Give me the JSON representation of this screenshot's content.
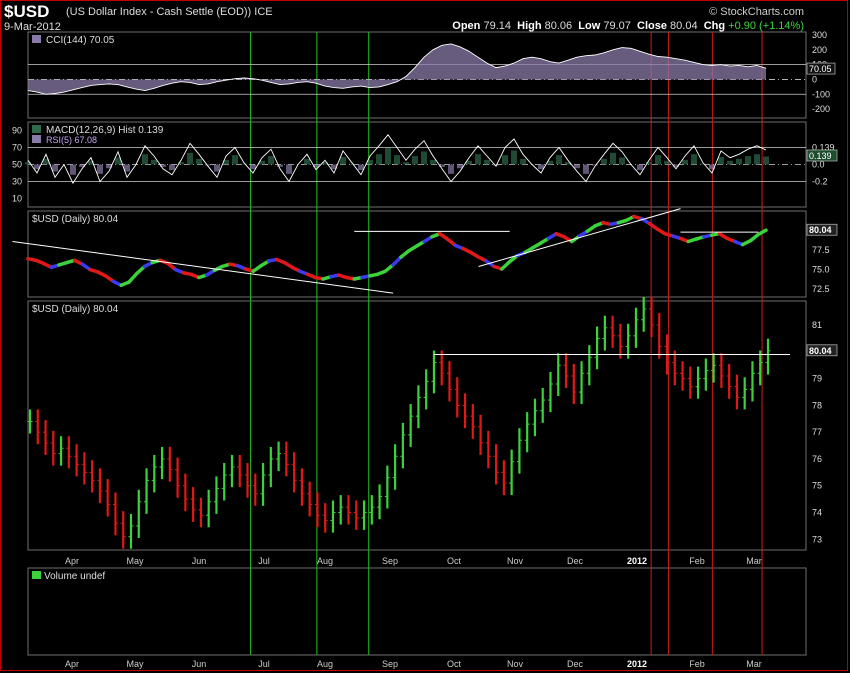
{
  "header": {
    "symbol": "$USD",
    "description": "(US Dollar Index - Cash Settle (EOD))",
    "exchange": "ICE",
    "date": "9-Mar-2012",
    "brand": "© StockCharts.com",
    "open_label": "Open",
    "open": "79.14",
    "high_label": "High",
    "high": "80.06",
    "low_label": "Low",
    "low": "79.07",
    "close_label": "Close",
    "close": "80.04",
    "chg_label": "Chg",
    "chg": "+0.90 (+1.14%)"
  },
  "colors": {
    "background": "#000000",
    "frame": "#c00000",
    "panel_border": "#6e6e6e",
    "up_bar": "#3cd23c",
    "down_bar": "#e01818",
    "blue_bar": "#3a3af0",
    "oscillator_fill": "#8a7aa8",
    "hist_fill": "#2f6a4a",
    "line": "#ffffff",
    "green_vline": "#20c020",
    "red_vline": "#d01a1a"
  },
  "chart_data": [
    {
      "type": "area",
      "name": "cci-panel",
      "title": "CCI(144) 70.05",
      "ylim": [
        -260,
        320
      ],
      "y_ticks": [
        300,
        200,
        100,
        0,
        -100,
        -200
      ],
      "ref_lines": [
        100,
        0,
        -100
      ],
      "last_value_label": "70.05",
      "values": [
        -75,
        -85,
        -100,
        -95,
        -85,
        -70,
        -55,
        -40,
        -35,
        -30,
        -35,
        -50,
        -65,
        -75,
        -60,
        -40,
        -25,
        -15,
        -20,
        -35,
        -30,
        -15,
        -5,
        5,
        10,
        5,
        -5,
        -20,
        -35,
        -30,
        -20,
        -15,
        -25,
        -45,
        -55,
        -60,
        -50,
        -45,
        -55,
        -50,
        -35,
        -15,
        20,
        80,
        150,
        200,
        230,
        240,
        220,
        190,
        150,
        110,
        80,
        90,
        110,
        140,
        150,
        140,
        120,
        110,
        130,
        150,
        160,
        165,
        180,
        200,
        215,
        210,
        190,
        170,
        155,
        150,
        140,
        130,
        115,
        100,
        95,
        100,
        90,
        95,
        85,
        95,
        75
      ]
    },
    {
      "type": "line",
      "name": "rsi-macd-panel",
      "title": "MACD(12,26,9) Hist 0.139",
      "subtitle": "RSI(5) 67.08",
      "ylim": [
        0,
        100
      ],
      "y_ticks": [
        90,
        70,
        50,
        30,
        10
      ],
      "ref_lines": [
        70,
        50,
        30
      ],
      "right_ticks": [
        "0.139",
        "0.0",
        "-0.2"
      ],
      "last_value_label": "0.139",
      "values": [
        55,
        40,
        62,
        35,
        50,
        28,
        45,
        58,
        30,
        42,
        65,
        35,
        50,
        72,
        60,
        45,
        38,
        55,
        75,
        62,
        48,
        35,
        60,
        70,
        52,
        40,
        58,
        68,
        45,
        30,
        50,
        62,
        44,
        55,
        40,
        66,
        52,
        38,
        60,
        72,
        85,
        70,
        55,
        68,
        78,
        60,
        45,
        30,
        42,
        58,
        72,
        60,
        48,
        70,
        80,
        62,
        50,
        40,
        58,
        70,
        55,
        42,
        30,
        48,
        62,
        75,
        65,
        50,
        38,
        55,
        70,
        58,
        45,
        60,
        72,
        52,
        40,
        66,
        58,
        62,
        68,
        72,
        67.08
      ]
    },
    {
      "type": "line",
      "name": "daily-line-panel",
      "title": "$USD (Daily) 80.04",
      "ylim": [
        71.5,
        82.5
      ],
      "y_ticks": [
        80,
        77.5,
        75,
        72.5
      ],
      "last_value_label": "80.04",
      "values": [
        76.4,
        76.2,
        75.8,
        75.3,
        75.6,
        75.9,
        76.2,
        75.7,
        75.0,
        74.7,
        74.2,
        73.5,
        73.0,
        73.4,
        74.5,
        75.4,
        75.9,
        76.2,
        75.8,
        75.0,
        74.6,
        74.4,
        74.0,
        74.3,
        74.9,
        75.4,
        75.7,
        75.5,
        75.1,
        74.8,
        75.5,
        76.1,
        76.3,
        75.9,
        75.3,
        74.8,
        74.4,
        74.0,
        73.8,
        74.1,
        74.3,
        74.0,
        73.8,
        74.0,
        74.2,
        74.4,
        74.8,
        75.6,
        76.6,
        77.4,
        78.0,
        78.6,
        79.2,
        79.6,
        78.9,
        78.1,
        77.7,
        77.2,
        76.6,
        76.1,
        75.4,
        75.1,
        76.0,
        76.8,
        77.2,
        77.8,
        78.4,
        79.0,
        79.6,
        79.2,
        78.6,
        79.3,
        79.9,
        80.6,
        81.0,
        80.8,
        81.0,
        81.3,
        81.8,
        81.5,
        80.9,
        80.2,
        79.6,
        79.3,
        79.0,
        78.6,
        78.9,
        79.2,
        79.4,
        79.6,
        79.0,
        78.6,
        78.2,
        78.7,
        79.5,
        80.04
      ],
      "annotation_lines": [
        {
          "from": [
            -2,
            78.6
          ],
          "to": [
            47,
            72.0
          ]
        },
        {
          "from": [
            42,
            79.9
          ],
          "to": [
            62,
            79.9
          ]
        },
        {
          "from": [
            58,
            75.4
          ],
          "to": [
            84,
            82.8
          ]
        },
        {
          "from": [
            84,
            79.8
          ],
          "to": [
            94,
            79.8
          ]
        }
      ]
    },
    {
      "type": "bar",
      "name": "price-panel",
      "title": "$USD (Daily) 80.04",
      "ylim": [
        72.6,
        81.9
      ],
      "y_ticks": [
        81,
        80,
        79,
        78,
        77,
        76,
        75,
        74,
        73
      ],
      "last_value_label": "80.04",
      "resistance_line": 79.9,
      "x_ticks": [
        "Apr",
        "May",
        "Jun",
        "Jul",
        "Aug",
        "Sep",
        "Oct",
        "Nov",
        "Dec",
        "2012",
        "Feb",
        "Mar"
      ],
      "values": [
        77.4,
        77.0,
        76.6,
        76.2,
        76.4,
        76.1,
        75.8,
        75.5,
        75.2,
        74.8,
        74.3,
        73.6,
        73.1,
        73.5,
        74.4,
        75.2,
        75.7,
        76.0,
        75.6,
        75.0,
        74.5,
        74.1,
        73.9,
        74.4,
        74.9,
        75.4,
        75.7,
        75.4,
        75.0,
        74.7,
        75.4,
        76.0,
        76.2,
        75.8,
        75.2,
        74.7,
        74.3,
        73.9,
        73.7,
        74.0,
        74.2,
        74.0,
        73.8,
        74.0,
        74.2,
        74.6,
        75.3,
        76.1,
        76.9,
        77.6,
        78.3,
        78.9,
        79.6,
        79.2,
        78.6,
        78.0,
        77.6,
        77.2,
        76.6,
        76.1,
        75.5,
        75.1,
        75.9,
        76.7,
        77.3,
        77.8,
        78.2,
        78.8,
        79.5,
        79.1,
        78.5,
        79.2,
        79.8,
        80.5,
        80.9,
        80.6,
        80.2,
        80.6,
        81.2,
        81.6,
        81.0,
        80.2,
        79.6,
        79.2,
        79.0,
        78.7,
        79.0,
        79.3,
        79.5,
        79.1,
        78.7,
        78.3,
        78.6,
        79.2,
        79.6,
        80.04
      ]
    },
    {
      "type": "bar",
      "name": "volume-panel",
      "title": "Volume undef",
      "x_ticks": [
        "Apr",
        "May",
        "Jun",
        "Jul",
        "Aug",
        "Sep",
        "Oct",
        "Nov",
        "Dec",
        "2012",
        "Feb",
        "Mar"
      ],
      "values": []
    }
  ],
  "markers": {
    "green_vlines": [
      30.4,
      39.6,
      46.8
    ],
    "red_vlines": [
      86.0,
      88.4,
      94.5,
      101.4
    ]
  }
}
